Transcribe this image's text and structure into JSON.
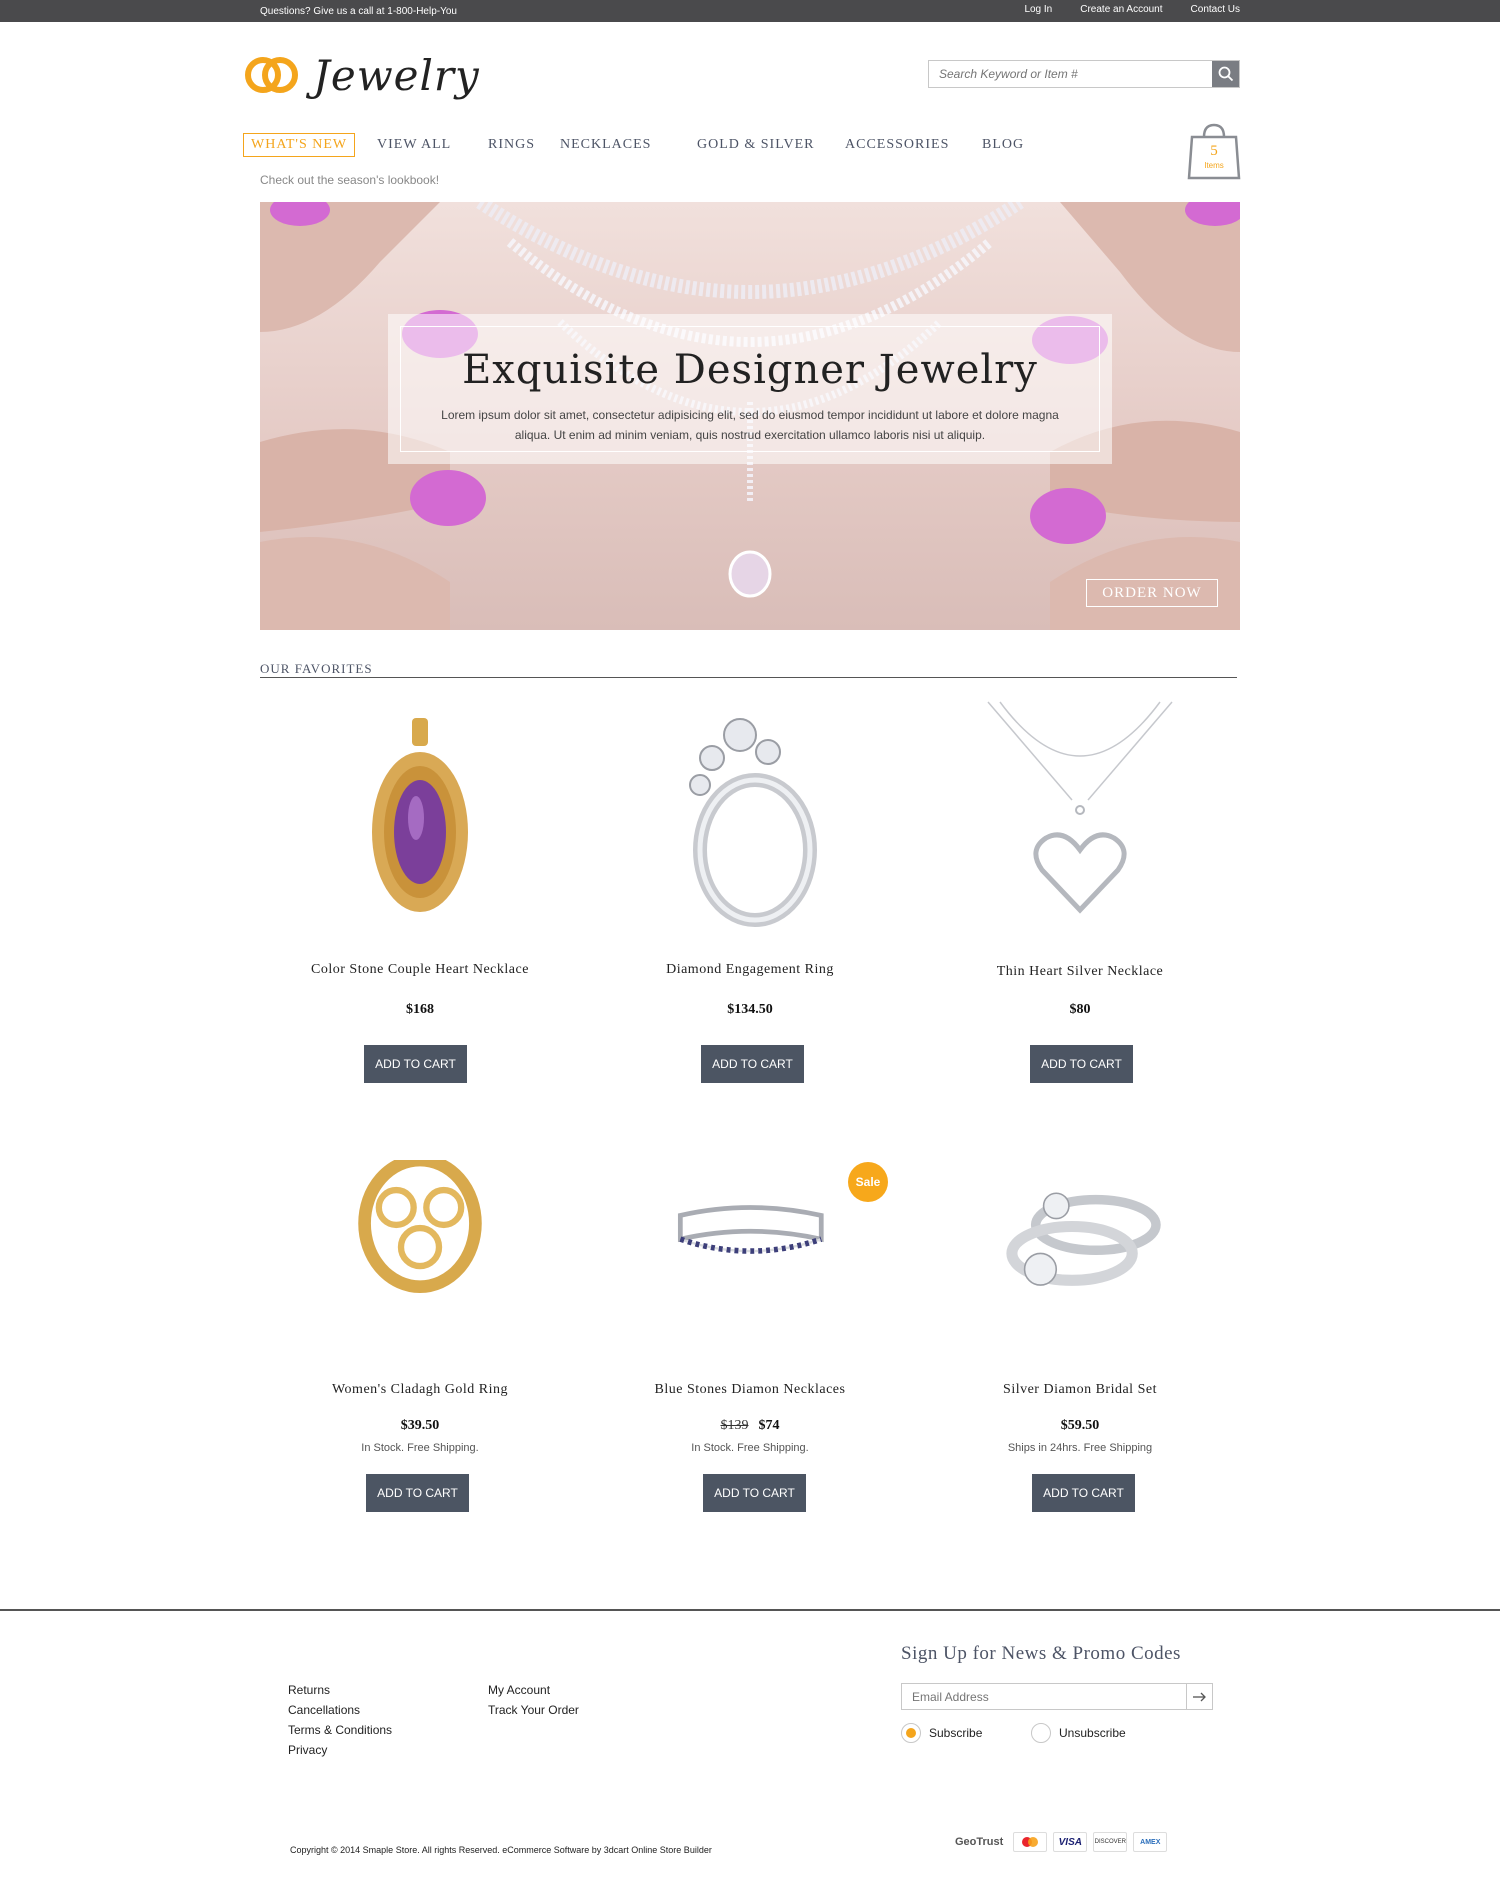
{
  "topbar": {
    "phone": "Questions? Give us a call at 1-800-Help-You",
    "login": "Log In",
    "create_account": "Create an Account",
    "contact": "Contact Us"
  },
  "brand": {
    "name": "Jewelry",
    "accent": "#f4a51c"
  },
  "search": {
    "placeholder": "Search Keyword or Item #",
    "icon": "search-icon"
  },
  "nav": {
    "items": [
      "WHAT'S NEW",
      "VIEW ALL",
      "RINGS",
      "NECKLACES",
      "GOLD & SILVER",
      "ACCESSORIES",
      "BLOG"
    ],
    "active": "WHAT'S NEW",
    "subtext": "Check out the season's lookbook!"
  },
  "cart": {
    "count": "5",
    "label": "Items"
  },
  "hero": {
    "title": "Exquisite Designer Jewelry",
    "text": "Lorem ipsum dolor sit amet, consectetur adipisicing elit, sed do eiusmod tempor incididunt ut labore et dolore magna aliqua. Ut enim ad minim veniam, quis nostrud exercitation ullamco laboris nisi ut aliquip.",
    "cta": "ORDER NOW"
  },
  "favorites": {
    "title": "OUR FAVORITES",
    "products": [
      {
        "name": "Color Stone Couple Heart Necklace",
        "price": "$168",
        "old_price": "",
        "stock": "",
        "cta": "ADD TO CART"
      },
      {
        "name": "Diamond Engagement Ring",
        "price": "$134.50",
        "old_price": "",
        "stock": "",
        "cta": "ADD TO CART"
      },
      {
        "name": "Thin Heart Silver Necklace",
        "price": "$80",
        "old_price": "",
        "stock": "",
        "cta": "ADD TO CART"
      },
      {
        "name": "Women's Cladagh Gold Ring",
        "price": "$39.50",
        "old_price": "",
        "stock": "In Stock. Free Shipping.",
        "cta": "ADD TO CART"
      },
      {
        "name": "Blue Stones Diamon Necklaces",
        "price": "$74",
        "old_price": "$139",
        "stock": "In Stock. Free Shipping.",
        "cta": "ADD TO CART",
        "badge": "Sale"
      },
      {
        "name": "Silver Diamon Bridal Set",
        "price": "$59.50",
        "old_price": "",
        "stock": "Ships in 24hrs. Free Shipping",
        "cta": "ADD TO CART"
      }
    ]
  },
  "footer": {
    "links_col1": [
      "Returns",
      "Cancellations",
      "Terms & Conditions",
      "Privacy"
    ],
    "links_col2": [
      "My Account",
      "Track Your Order"
    ],
    "newsletter_title": "Sign Up for News & Promo Codes",
    "email_placeholder": "Email Address",
    "subscribe": "Subscribe",
    "unsubscribe": "Unsubscribe",
    "copyright": "Copyright © 2014 Smaple Store. All rights Reserved. eCommerce Software by 3dcart Online Store Builder",
    "badges": [
      "GeoTrust",
      "mastercard",
      "VISA",
      "DISCOVER",
      "AMEX"
    ]
  }
}
